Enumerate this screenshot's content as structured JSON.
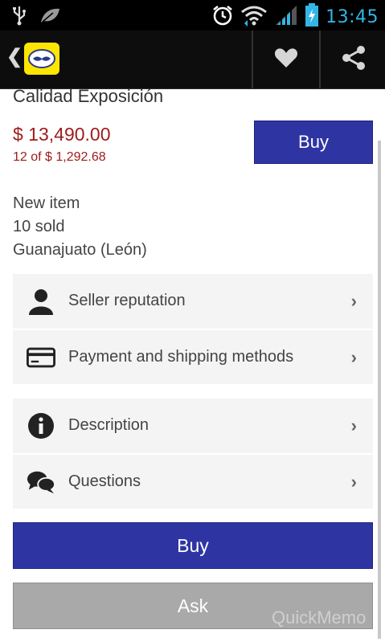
{
  "status_bar": {
    "time": "13:45",
    "icons": [
      "usb-icon",
      "leaf-icon",
      "alarm-icon",
      "wifi-icon",
      "signal-icon",
      "battery-icon"
    ]
  },
  "action_bar": {
    "back_icon": "chevron-left-icon",
    "app_logo": "mercadolibre-logo",
    "favorite_icon": "heart-icon",
    "share_icon": "share-icon"
  },
  "product": {
    "title": "Calidad Exposición",
    "price": "$ 13,490.00",
    "installments_count": "12",
    "installments_of": "of",
    "installment_amount": "$ 1,292.68",
    "buy_label": "Buy",
    "condition": "New item",
    "sold": "10 sold",
    "location": "Guanajuato (León)"
  },
  "sections": {
    "group1": [
      {
        "label": "Seller reputation",
        "icon": "person-icon"
      },
      {
        "label": "Payment and shipping methods",
        "icon": "credit-card-icon"
      }
    ],
    "group2": [
      {
        "label": "Description",
        "icon": "info-icon"
      },
      {
        "label": "Questions",
        "icon": "chat-bubbles-icon"
      }
    ]
  },
  "actions": {
    "buy_label": "Buy",
    "ask_label": "Ask"
  },
  "watermark": "QuickMemo",
  "colors": {
    "accent_blue": "#2e35a3",
    "price_red": "#a01c1c",
    "clock_blue": "#33b5e5",
    "logo_yellow": "#ffe600",
    "ask_gray": "#a9a9a9"
  }
}
